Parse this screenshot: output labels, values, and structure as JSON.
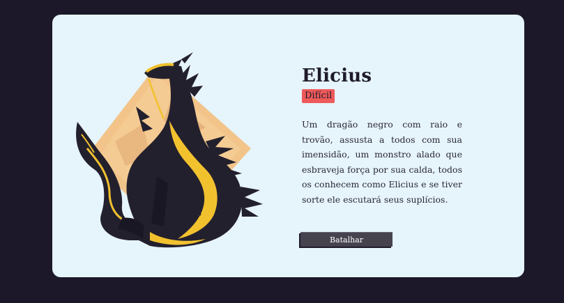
{
  "monster": {
    "name": "Elicius",
    "difficulty": "Difícil",
    "description": "Um dragão negro com raio e trovão, assusta a todos com sua imensidão, um monstro alado que esbraveja força por sua calda, todos os conhecem como Elicius e se tiver sorte ele escutará seus suplícios.",
    "image_icon": "black-dragon-illustration"
  },
  "actions": {
    "battle_label": "Batalhar"
  },
  "colors": {
    "page_background": "#1c1829",
    "card_background": "#e6f4fb",
    "badge_background": "#ee5a5a",
    "button_background": "#46434f",
    "dragon_body": "#23202e",
    "dragon_accent": "#f2c12e",
    "backdrop": "#f2c48a"
  }
}
